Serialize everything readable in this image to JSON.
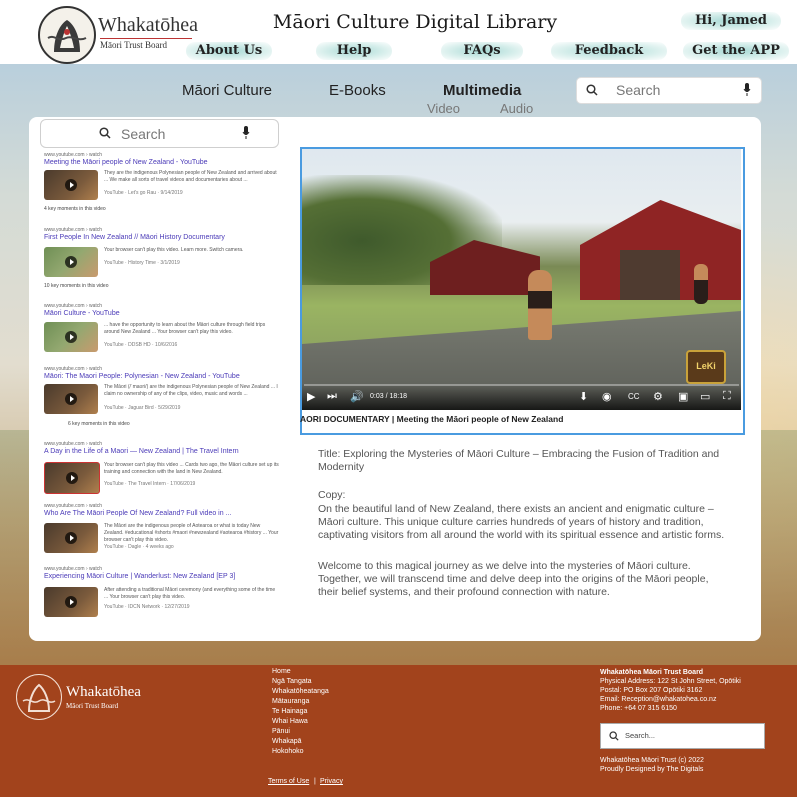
{
  "header": {
    "brand_name": "Whakatōhea",
    "brand_sub": "Māori Trust Board",
    "site_title": "Māori Culture Digital Library",
    "greeting": "Hi, Jamed",
    "nav": [
      "About Us",
      "Help",
      "FAQs",
      "Feedback",
      "Get the APP"
    ]
  },
  "categories": {
    "tabs": [
      "Māori Culture",
      "E-Books",
      "Multimedia"
    ],
    "sub_tabs": [
      "Video",
      "Audio"
    ],
    "search_placeholder": "Search"
  },
  "left_search": {
    "placeholder": "Search"
  },
  "results": [
    {
      "url": "www.youtube.com › watch",
      "title": "Meeting the Māori people of New Zealand - YouTube",
      "desc": "They are the indigenous Polynesian people of New Zealand and arrived about ... We make all sorts of travel videos and documentaries about ...",
      "meta": "YouTube · Let's go Rau · 9/14/2019",
      "moments": "4 key moments in this video"
    },
    {
      "url": "www.youtube.com › watch",
      "title": "First People In New Zealand // Māori History Documentary",
      "desc": "Your browser can't play this video. Learn more. Switch camera.",
      "meta": "YouTube · History Time · 3/1/2019",
      "moments": "10 key moments in this video"
    },
    {
      "url": "www.youtube.com › watch",
      "title": "Māori Culture - YouTube",
      "desc": "... have the opportunity to learn about the Māori culture through field trips around New Zealand ... Your browser can't play this video.",
      "meta": "YouTube · DDSB HD · 10/6/2016",
      "moments": ""
    },
    {
      "url": "www.youtube.com › watch",
      "title": "Māori: The Maori People: Polynesian - New Zealand - YouTube",
      "desc": "The Māori (/ˈmaʊri/) are the indigenous Polynesian people of New Zealand ... I claim no ownership of any of the clips, video, music and words ...",
      "meta": "YouTube · Jaguar Bird · 5/29/2019",
      "moments": "6 key moments in this video"
    },
    {
      "url": "www.youtube.com › watch",
      "title": "A Day in the Life of a Maori — New Zealand | The Travel Intern",
      "desc": "Your browser can't play this video ... Cards two ago, the Māori culture set up its training and connection with the land in New Zealand.",
      "meta": "YouTube · The Travel Intern · 17/06/2019",
      "moments": ""
    },
    {
      "url": "www.youtube.com › watch",
      "title": "Who Are The Māori People Of New Zealand? Full video in ...",
      "desc": "The Māori are the indigenous people of Aotearoa or what is today New Zealand. #educational #shorts #maori #newzealand #aotearoa #history ... Your browser can't play this video.",
      "meta": "YouTube · Dagle · 4 weeks ago",
      "moments": ""
    },
    {
      "url": "www.youtube.com › watch",
      "title": "Experiencing Māori Culture | Wanderlust: New Zealand [EP 3]",
      "desc": "After attending a traditional Māori ceremony (and everything some of the time ... Your browser can't play this video.",
      "meta": "YouTube · IDCN Network · 12/27/2019",
      "moments": ""
    }
  ],
  "video": {
    "caption": "AORI DOCUMENTARY | Meeting the Māori people of New Zealand",
    "time": "0:03 / 18:18",
    "channel_logo": "LeKi"
  },
  "description": {
    "title": "Title: Exploring the Mysteries of Māori Culture – Embracing the Fusion of Tradition and Modernity",
    "copy_label": "Copy:",
    "para1": "On the beautiful land of New Zealand, there exists an ancient and enigmatic culture – Māori culture. This unique culture carries hundreds of years of history and tradition, captivating visitors from all around the world with its spiritual essence and artistic forms.",
    "para2": "Welcome to this magical journey as we delve into the mysteries of Māori culture. Together, we will transcend time and delve deep into the origins of the Māori people, their belief systems, and their profound connection with nature."
  },
  "footer": {
    "brand_name": "Whakatōhea",
    "brand_sub": "Māori Trust Board",
    "links": [
      "Home",
      "Ngā Tangata",
      "Whakatōheatanga",
      "Mātauranga",
      "Te Hainaga",
      "Whai Hawa",
      "Pānui",
      "Whakapā",
      "Hokohoko"
    ],
    "legal": [
      "Terms of Use",
      "Privacy"
    ],
    "org": "Whakatōhea Māori Trust Board",
    "physical": "Physical Address: 122 St John Street, Opōtiki",
    "postal": "Postal: PO Box 207 Opōtiki 3162",
    "email": "Email: Reception@whakatohea.co.nz",
    "phone": "Phone: +64 07 315 6150",
    "search_placeholder": "Search...",
    "copyright": "Whakatōhea Māori Trust (c) 2022",
    "designed": "Proudly Designed by The Digitals"
  },
  "colors": {
    "footer_bg": "#a2431c",
    "link_purple": "#4b3bb8",
    "video_border": "#4a9be0",
    "nav_highlight": "#a6d8d4"
  }
}
